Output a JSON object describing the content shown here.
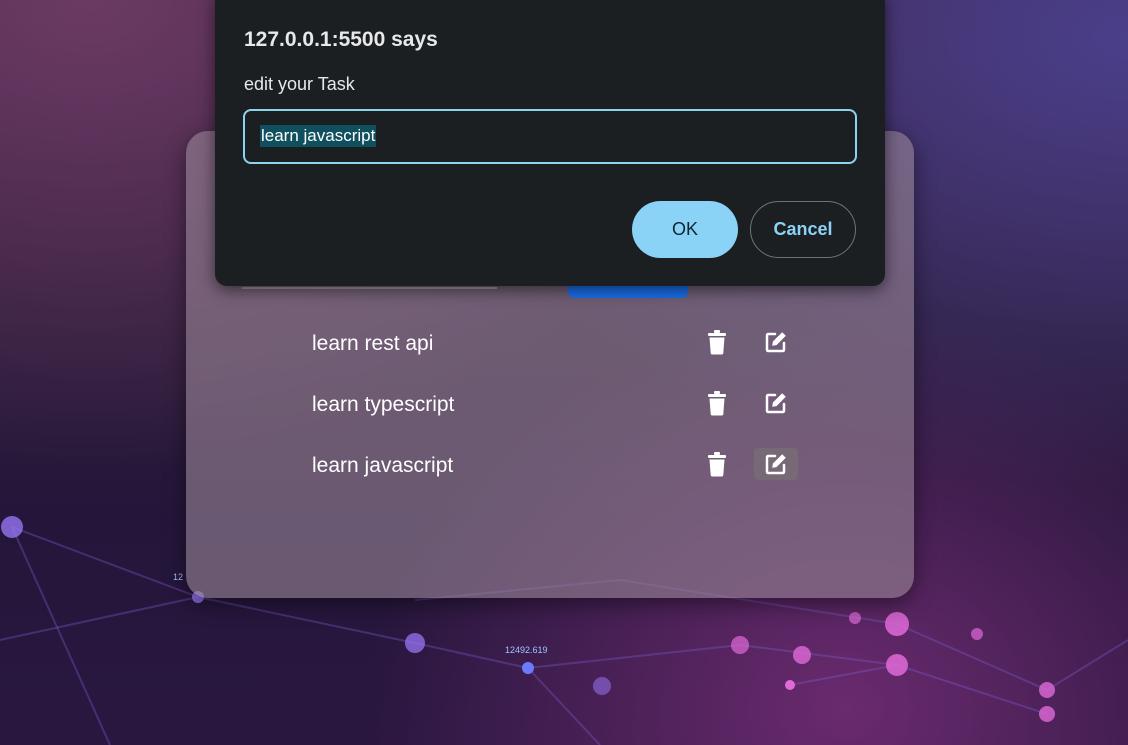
{
  "dialog": {
    "title": "127.0.0.1:5500 says",
    "message": "edit your Task",
    "input_value": "learn javascript",
    "ok_label": "OK",
    "cancel_label": "Cancel"
  },
  "background": {
    "labels": [
      "12492.619",
      "12"
    ]
  },
  "tasks": [
    {
      "text": "learn rest api",
      "delete_icon": "trash-icon",
      "edit_icon": "edit-icon"
    },
    {
      "text": "learn typescript",
      "delete_icon": "trash-icon",
      "edit_icon": "edit-icon"
    },
    {
      "text": "learn javascript",
      "delete_icon": "trash-icon",
      "edit_icon": "edit-icon"
    }
  ],
  "colors": {
    "accent": "#8bd3f6",
    "add_button": "#1a6ee8",
    "dialog_bg": "#1b1f22"
  }
}
